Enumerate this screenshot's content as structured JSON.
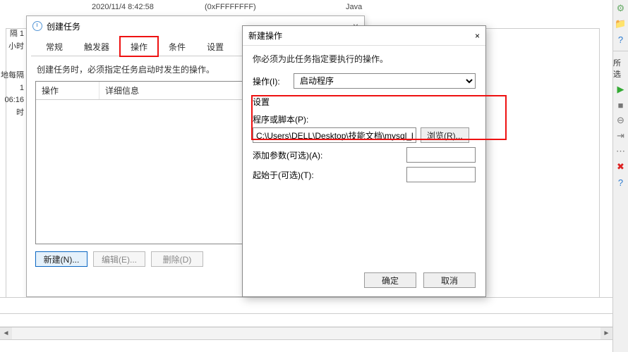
{
  "bg": {
    "date1": "2020/11/4 8:42:58",
    "hex": "(0xFFFFFFFF)",
    "java": "Java",
    "left1": "隔 1 小时",
    "left2": "地每隔 1",
    "left3": "06:16 时"
  },
  "win1": {
    "title": "创建任务",
    "close": "×",
    "tabs": [
      "常规",
      "触发器",
      "操作",
      "条件",
      "设置"
    ],
    "active_tab_index": 2,
    "desc": "创建任务时，必须指定任务启动时发生的操作。",
    "col1": "操作",
    "col2": "详细信息",
    "btn_new": "新建(N)...",
    "btn_edit": "编辑(E)...",
    "btn_delete": "删除(D)"
  },
  "win2": {
    "title": "新建操作",
    "close": "×",
    "intro": "你必须为此任务指定要执行的操作。",
    "op_label": "操作(I):",
    "op_value": "启动程序",
    "group_title": "设置",
    "script_label": "程序或脚本(P):",
    "script_value": "C:\\Users\\DELL\\Desktop\\技能文档\\mysql_back.bat",
    "browse": "浏览(R)...",
    "args_label": "添加参数(可选)(A):",
    "args_value": "",
    "start_label": "起始于(可选)(T):",
    "start_value": "",
    "ok": "确定",
    "cancel": "取消"
  },
  "rightbar": {
    "label": "所选"
  }
}
